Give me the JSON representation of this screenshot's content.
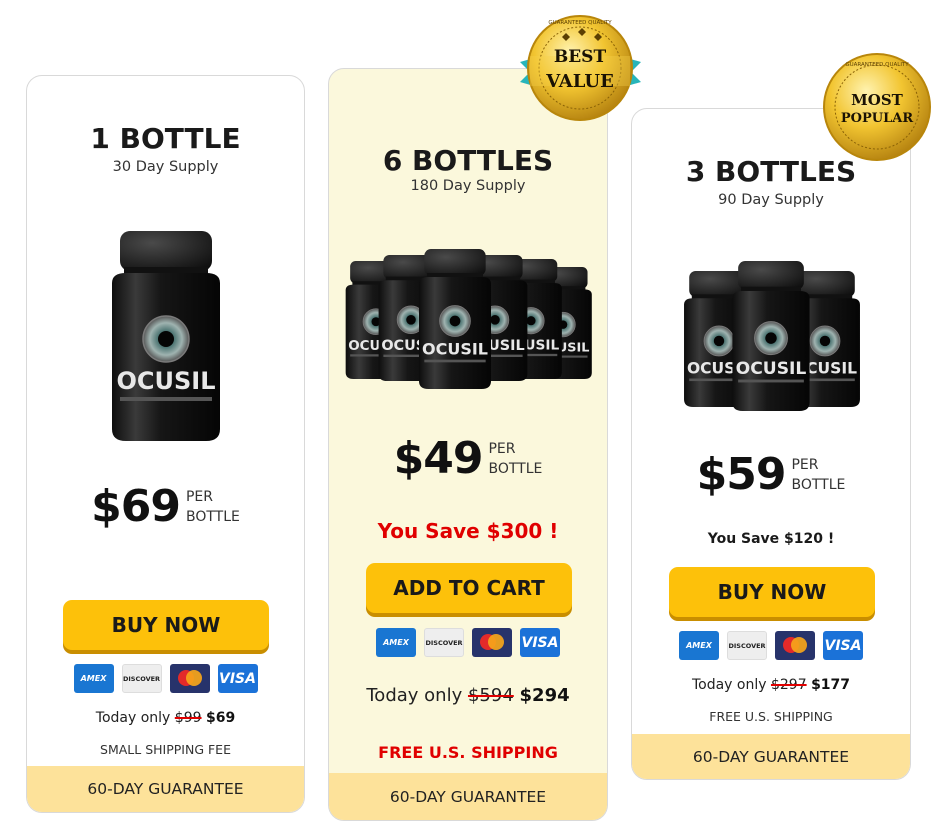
{
  "cards": {
    "one": {
      "title": "1 BOTTLE",
      "subtitle": "30 Day Supply",
      "price": "$69",
      "per": "PER",
      "per2": "BOTTLE",
      "button": "BUY NOW",
      "today_label": "Today only",
      "old_price": "$99",
      "new_price": "$69",
      "shipping": "SMALL SHIPPING FEE",
      "guarantee": "60-DAY GUARANTEE"
    },
    "six": {
      "title": "6 BOTTLES",
      "subtitle": "180 Day Supply",
      "price": "$49",
      "per": "PER",
      "per2": "BOTTLE",
      "save": "You Save $300 !",
      "button": "ADD TO CART",
      "today_label": "Today only",
      "old_price": "$594",
      "new_price": "$294",
      "shipping": "FREE U.S. SHIPPING",
      "guarantee": "60-DAY GUARANTEE",
      "badge_line1": "BEST",
      "badge_line2": "VALUE",
      "badge_ring": "GUARANTEED QUALITY"
    },
    "three": {
      "title": "3 BOTTLES",
      "subtitle": "90 Day Supply",
      "price": "$59",
      "per": "PER",
      "per2": "BOTTLE",
      "save": "You Save $120 !",
      "button": "BUY NOW",
      "today_label": "Today only",
      "old_price": "$297",
      "new_price": "$177",
      "shipping": "FREE U.S. SHIPPING",
      "guarantee": "60-DAY GUARANTEE",
      "badge_line1": "MOST",
      "badge_line2": "POPULAR",
      "badge_ring": "GUARANTEED QUALITY"
    }
  },
  "product": {
    "brand": "OCUSIL",
    "tagline": "DIETARY SUPPLEMENT"
  },
  "payments": {
    "amex": "AMEX",
    "discover": "DISCOVER",
    "visa": "VISA"
  },
  "colors": {
    "button": "#fdc10a",
    "guarantee_bar": "#fde29a",
    "highlight_card": "#fbf8dc",
    "accent_red": "#e00000"
  }
}
